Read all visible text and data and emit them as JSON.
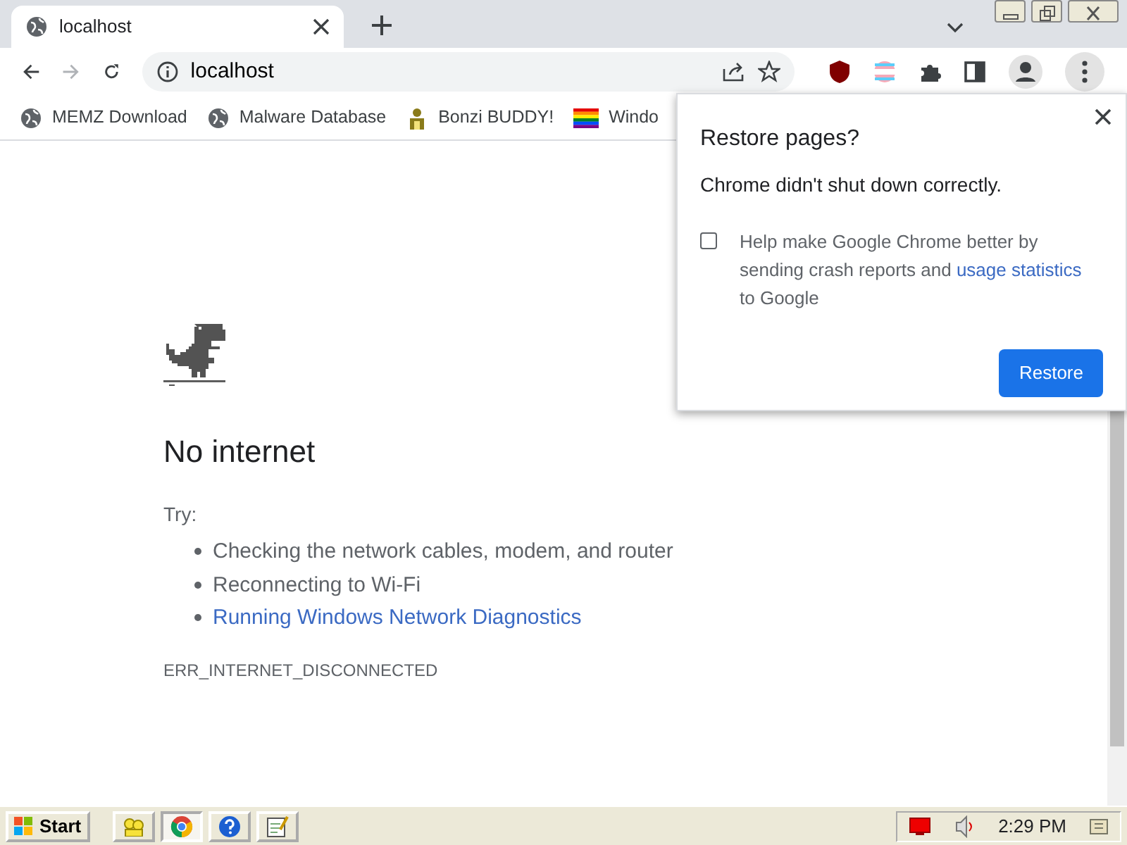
{
  "tabs": [
    {
      "title": "localhost",
      "selected": true
    }
  ],
  "address_bar": {
    "url": "localhost"
  },
  "bookmarks": [
    {
      "label": "MEMZ Download",
      "kind": "globe"
    },
    {
      "label": "Malware Database",
      "kind": "globe"
    },
    {
      "label": "Bonzi BUDDY!",
      "kind": "figure"
    },
    {
      "label": "Windo",
      "kind": "flag"
    }
  ],
  "restore_dialog": {
    "title": "Restore pages?",
    "message": "Chrome didn't shut down correctly.",
    "checkbox": {
      "text_before": "Help make Google Chrome better by sending crash reports and ",
      "link": "usage statistics",
      "text_after": " to Google",
      "checked": false
    },
    "button": "Restore"
  },
  "error_page": {
    "heading": "No internet",
    "try_label": "Try:",
    "suggestions": [
      {
        "text": "Checking the network cables, modem, and router",
        "kind": "text"
      },
      {
        "text": "Reconnecting to Wi-Fi",
        "kind": "text"
      },
      {
        "text": "Running Windows Network Diagnostics",
        "kind": "link"
      }
    ],
    "error_code": "ERR_INTERNET_DISCONNECTED"
  },
  "taskbar": {
    "start": "Start",
    "quick_launch": [
      {
        "kind": "people",
        "selected": false
      },
      {
        "kind": "chrome",
        "selected": true
      },
      {
        "kind": "help",
        "selected": false
      },
      {
        "kind": "notepad",
        "selected": false
      }
    ],
    "clock": "2:29 PM"
  }
}
